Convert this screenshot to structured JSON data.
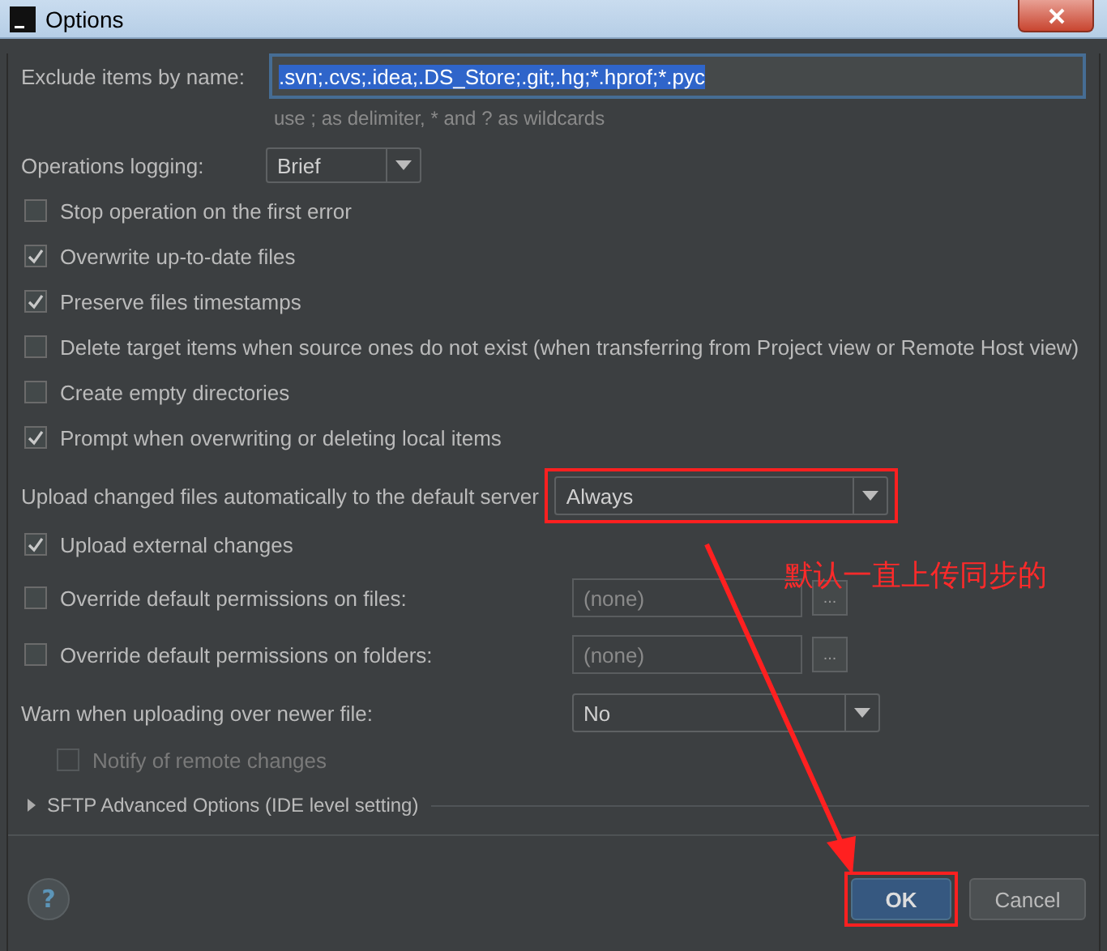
{
  "window": {
    "title": "Options"
  },
  "exclude": {
    "label": "Exclude items by name:",
    "value": ".svn;.cvs;.idea;.DS_Store;.git;.hg;*.hprof;*.pyc",
    "text_selected": true,
    "hint": "use ; as delimiter, * and ? as wildcards"
  },
  "operations_logging": {
    "label": "Operations logging:",
    "value": "Brief"
  },
  "options": [
    {
      "label": "Stop operation on the first error",
      "checked": false
    },
    {
      "label": "Overwrite up-to-date files",
      "checked": true
    },
    {
      "label": "Preserve files timestamps",
      "checked": true
    },
    {
      "label": "Delete target items when source ones do not exist (when transferring from Project view or Remote Host view)",
      "checked": false
    },
    {
      "label": "Create empty directories",
      "checked": false
    },
    {
      "label": "Prompt when overwriting or deleting local items",
      "checked": true
    }
  ],
  "upload": {
    "label": "Upload changed files automatically to the default server",
    "value": "Always"
  },
  "upload_external": {
    "label": "Upload external changes",
    "checked": true
  },
  "permissions": [
    {
      "label": "Override default permissions on files:",
      "checked": false,
      "placeholder": "(none)",
      "disabled": true,
      "button": "..."
    },
    {
      "label": "Override default permissions on folders:",
      "checked": false,
      "placeholder": "(none)",
      "disabled": true,
      "button": "..."
    }
  ],
  "warn": {
    "label": "Warn when uploading over newer file:",
    "value": "No"
  },
  "notify": {
    "label": "Notify of remote changes",
    "checked": false,
    "disabled": true
  },
  "sftp": {
    "label": "SFTP Advanced Options (IDE level setting)",
    "expanded": false
  },
  "help": {
    "label": "?"
  },
  "buttons": [
    {
      "label": "OK",
      "kind": "primary"
    },
    {
      "label": "Cancel",
      "kind": "normal"
    }
  ],
  "annotation": {
    "text": "默认一直上传同步的"
  }
}
